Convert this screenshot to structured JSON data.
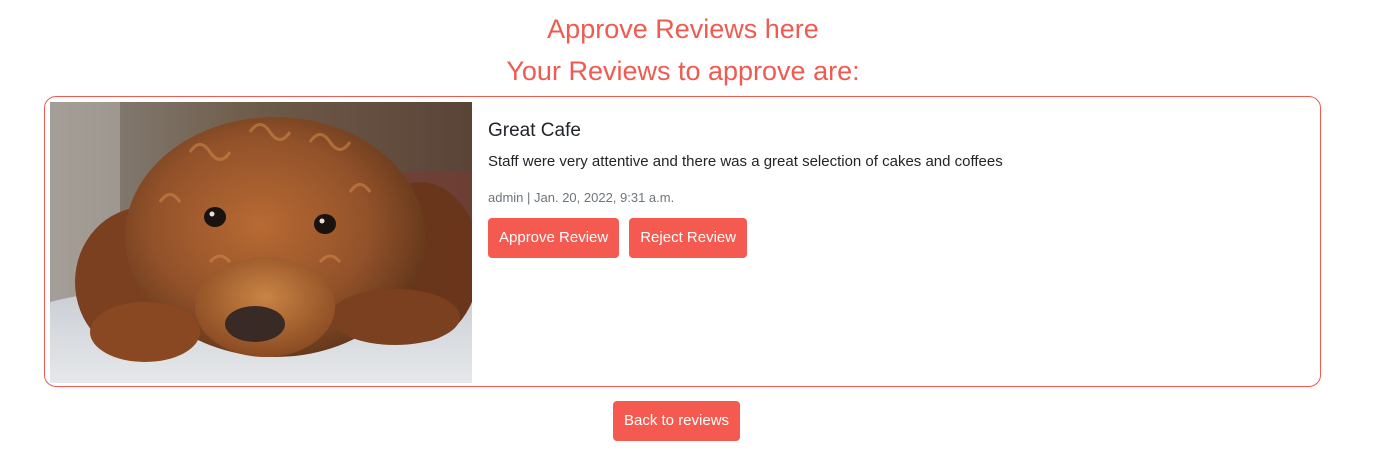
{
  "header": {
    "title": "Approve Reviews here",
    "subtitle": "Your Reviews to approve are:"
  },
  "reviews": [
    {
      "title": "Great Cafe",
      "text": "Staff were very attentive and there was a great selection of cakes and coffees",
      "meta": "admin | Jan. 20, 2022, 9:31 a.m.",
      "approve_label": "Approve Review",
      "reject_label": "Reject Review"
    }
  ],
  "footer": {
    "back_label": "Back to reviews"
  },
  "colors": {
    "accent": "#f55a50",
    "text": "#212529",
    "muted": "#6c757d"
  }
}
